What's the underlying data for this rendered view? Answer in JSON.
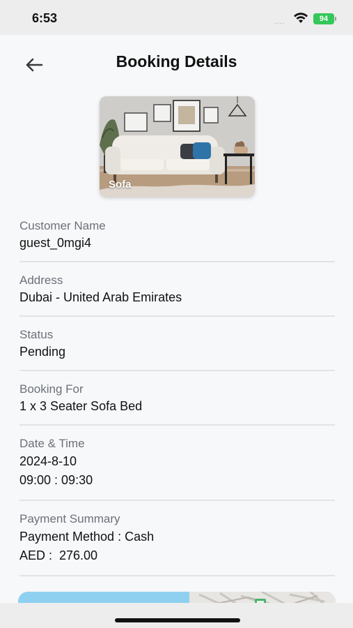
{
  "status_bar": {
    "time": "6:53",
    "signal_dots": "....",
    "battery": "94"
  },
  "header": {
    "title": "Booking Details",
    "back_icon": "arrow-left-icon"
  },
  "service": {
    "label": "Sofa"
  },
  "details": {
    "customer": {
      "label": "Customer Name",
      "value": "guest_0mgi4"
    },
    "address": {
      "label": "Address",
      "value": "Dubai - United Arab Emirates"
    },
    "status": {
      "label": "Status",
      "value": "Pending"
    },
    "booking_for": {
      "label": "Booking For",
      "value": "1 x 3 Seater Sofa Bed"
    },
    "date_time": {
      "label": "Date & Time",
      "date": "2024-8-10",
      "time": "09:00 : 09:30"
    },
    "payment": {
      "label": "Payment Summary",
      "method": "Payment Method : Cash",
      "amount": "AED :  276.00"
    }
  },
  "colors": {
    "background": "#f7f8fa",
    "divider": "#e1e3e6",
    "label": "#6b7078",
    "battery": "#34c759",
    "map_water": "#8fd0f0"
  }
}
